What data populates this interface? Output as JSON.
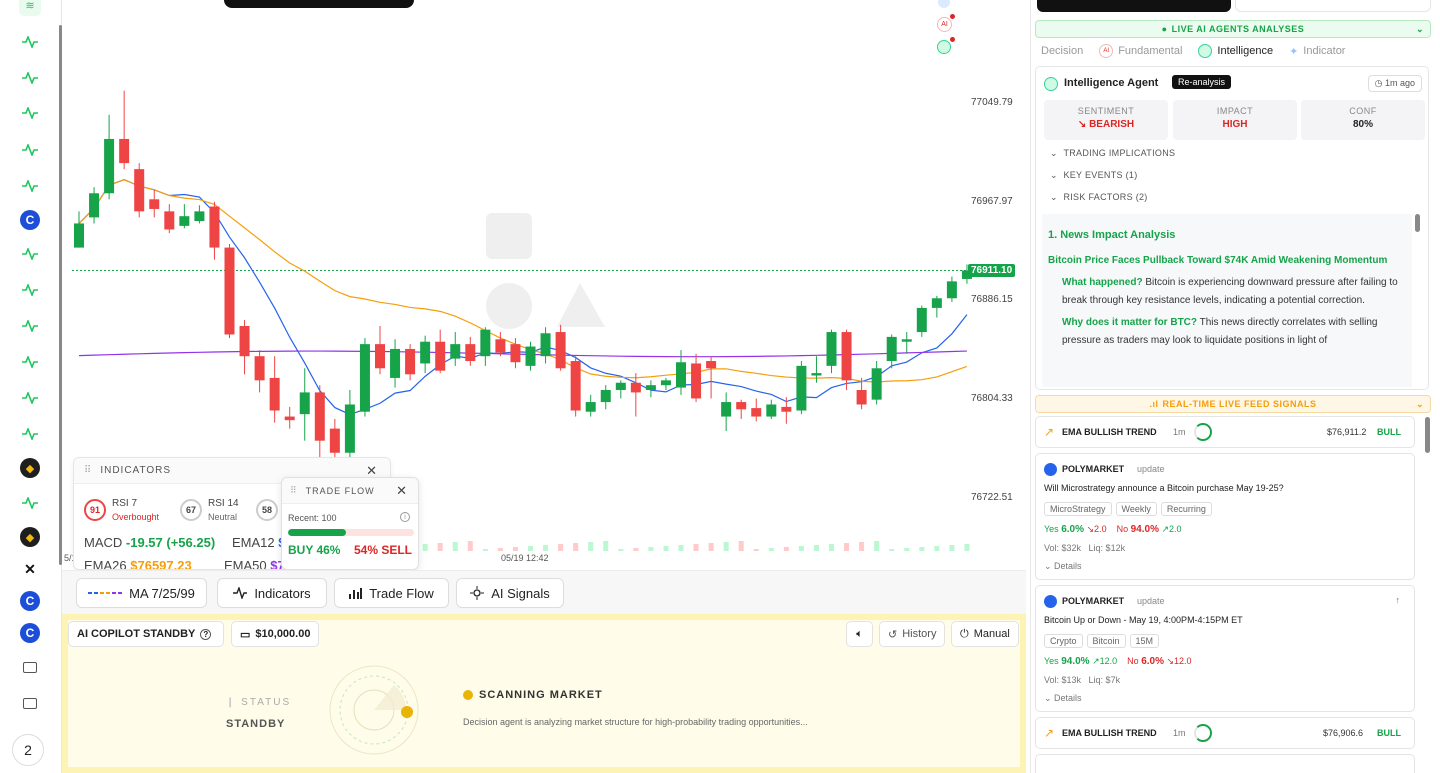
{
  "rail": {
    "icons": [
      "wifi-icon",
      "activity-icon",
      "activity-icon",
      "activity-icon",
      "activity-icon",
      "activity-icon",
      "coinbase-icon",
      "activity-icon",
      "activity-icon",
      "activity-icon",
      "activity-icon",
      "activity-icon",
      "activity-icon",
      "binance-icon",
      "activity-icon",
      "binance-icon",
      "okx-icon",
      "coinbase-icon",
      "coinbase-icon",
      "chat-icon",
      "chat-icon"
    ],
    "bottom_count": "2"
  },
  "chart": {
    "price_levels": [
      "77049.79",
      "76967.97",
      "76886.15",
      "76804.33",
      "76722.51"
    ],
    "current_price": "76911.10",
    "x_label": "05/19 12:42",
    "x_label_left": "5/1",
    "top_icons_badge": "AI"
  },
  "chart_data": {
    "type": "candlestick",
    "candles": [
      {
        "o": 76930,
        "c": 76950,
        "h": 76960,
        "l": 76930
      },
      {
        "o": 76955,
        "c": 76975,
        "h": 76980,
        "l": 76950
      },
      {
        "o": 76975,
        "c": 77020,
        "h": 77040,
        "l": 76970
      },
      {
        "o": 77020,
        "c": 77000,
        "h": 77060,
        "l": 76995
      },
      {
        "o": 76995,
        "c": 76960,
        "h": 77000,
        "l": 76955
      },
      {
        "o": 76970,
        "c": 76962,
        "h": 76978,
        "l": 76955
      },
      {
        "o": 76960,
        "c": 76945,
        "h": 76966,
        "l": 76942
      },
      {
        "o": 76948,
        "c": 76956,
        "h": 76966,
        "l": 76946
      },
      {
        "o": 76952,
        "c": 76960,
        "h": 76965,
        "l": 76950
      },
      {
        "o": 76964,
        "c": 76930,
        "h": 76968,
        "l": 76920
      },
      {
        "o": 76930,
        "c": 76858,
        "h": 76933,
        "l": 76855
      },
      {
        "o": 76865,
        "c": 76840,
        "h": 76870,
        "l": 76825
      },
      {
        "o": 76840,
        "c": 76820,
        "h": 76845,
        "l": 76810
      },
      {
        "o": 76822,
        "c": 76795,
        "h": 76840,
        "l": 76785
      },
      {
        "o": 76790,
        "c": 76787,
        "h": 76798,
        "l": 76780
      },
      {
        "o": 76792,
        "c": 76810,
        "h": 76830,
        "l": 76770
      },
      {
        "o": 76810,
        "c": 76770,
        "h": 76816,
        "l": 76755
      },
      {
        "o": 76780,
        "c": 76760,
        "h": 76788,
        "l": 76750
      },
      {
        "o": 76760,
        "c": 76800,
        "h": 76812,
        "l": 76732
      },
      {
        "o": 76794,
        "c": 76850,
        "h": 76855,
        "l": 76790
      },
      {
        "o": 76850,
        "c": 76830,
        "h": 76865,
        "l": 76825
      },
      {
        "o": 76822,
        "c": 76846,
        "h": 76854,
        "l": 76814
      },
      {
        "o": 76846,
        "c": 76825,
        "h": 76850,
        "l": 76820
      },
      {
        "o": 76834,
        "c": 76852,
        "h": 76857,
        "l": 76826
      },
      {
        "o": 76852,
        "c": 76828,
        "h": 76862,
        "l": 76826
      },
      {
        "o": 76838,
        "c": 76850,
        "h": 76860,
        "l": 76832
      },
      {
        "o": 76850,
        "c": 76836,
        "h": 76856,
        "l": 76832
      },
      {
        "o": 76840,
        "c": 76862,
        "h": 76864,
        "l": 76832
      },
      {
        "o": 76854,
        "c": 76843,
        "h": 76860,
        "l": 76840
      },
      {
        "o": 76850,
        "c": 76835,
        "h": 76855,
        "l": 76830
      },
      {
        "o": 76832,
        "c": 76848,
        "h": 76852,
        "l": 76828
      },
      {
        "o": 76840,
        "c": 76859,
        "h": 76864,
        "l": 76834
      },
      {
        "o": 76860,
        "c": 76830,
        "h": 76866,
        "l": 76828
      },
      {
        "o": 76836,
        "c": 76795,
        "h": 76840,
        "l": 76790
      },
      {
        "o": 76794,
        "c": 76802,
        "h": 76808,
        "l": 76790
      },
      {
        "o": 76802,
        "c": 76812,
        "h": 76816,
        "l": 76796
      },
      {
        "o": 76812,
        "c": 76818,
        "h": 76820,
        "l": 76805
      },
      {
        "o": 76818,
        "c": 76810,
        "h": 76826,
        "l": 76790
      },
      {
        "o": 76812,
        "c": 76816,
        "h": 76820,
        "l": 76806
      },
      {
        "o": 76816,
        "c": 76820,
        "h": 76822,
        "l": 76812
      },
      {
        "o": 76814,
        "c": 76835,
        "h": 76845,
        "l": 76808
      },
      {
        "o": 76834,
        "c": 76805,
        "h": 76842,
        "l": 76802
      },
      {
        "o": 76836,
        "c": 76830,
        "h": 76840,
        "l": 76805
      },
      {
        "o": 76790,
        "c": 76802,
        "h": 76810,
        "l": 76778
      },
      {
        "o": 76802,
        "c": 76796,
        "h": 76804,
        "l": 76788
      },
      {
        "o": 76797,
        "c": 76790,
        "h": 76805,
        "l": 76786
      },
      {
        "o": 76790,
        "c": 76800,
        "h": 76804,
        "l": 76788
      },
      {
        "o": 76798,
        "c": 76794,
        "h": 76806,
        "l": 76784
      },
      {
        "o": 76795,
        "c": 76832,
        "h": 76836,
        "l": 76792
      },
      {
        "o": 76824,
        "c": 76826,
        "h": 76840,
        "l": 76818
      },
      {
        "o": 76832,
        "c": 76860,
        "h": 76862,
        "l": 76826
      },
      {
        "o": 76860,
        "c": 76820,
        "h": 76862,
        "l": 76812
      },
      {
        "o": 76812,
        "c": 76800,
        "h": 76822,
        "l": 76796
      },
      {
        "o": 76804,
        "c": 76830,
        "h": 76836,
        "l": 76800
      },
      {
        "o": 76836,
        "c": 76856,
        "h": 76858,
        "l": 76830
      },
      {
        "o": 76852,
        "c": 76854,
        "h": 76860,
        "l": 76842
      },
      {
        "o": 76860,
        "c": 76880,
        "h": 76882,
        "l": 76856
      },
      {
        "o": 76880,
        "c": 76888,
        "h": 76890,
        "l": 76872
      },
      {
        "o": 76888,
        "c": 76902,
        "h": 76906,
        "l": 76885
      },
      {
        "o": 76904,
        "c": 76911,
        "h": 76916,
        "l": 76900
      }
    ],
    "series": [
      {
        "name": "MA 7",
        "color": "#2563eb"
      },
      {
        "name": "MA 25",
        "color": "#f59e0b"
      },
      {
        "name": "MA 99",
        "color": "#9333ea"
      }
    ],
    "ylim": [
      76722.51,
      77049.79
    ]
  },
  "indicators": {
    "title": "INDICATORS",
    "rsi7_label": "RSI 7",
    "rsi7_value": "91",
    "rsi7_state": "Overbought",
    "rsi14_label": "RSI 14",
    "rsi14_value": "67",
    "rsi14_state": "Neutral",
    "rsi_third_value": "58",
    "macd_label": "MACD",
    "macd_value": "-19.57 (+56.25)",
    "ema12_label": "EMA12",
    "ema12_value": "$",
    "ema26_label": "EMA26",
    "ema26_value": "$76597.23",
    "ema50_label": "EMA50",
    "ema50_value": "$76"
  },
  "trade_flow": {
    "title": "TRADE FLOW",
    "recent": "Recent: 100",
    "buy_pct": 0.46,
    "buy_label": "BUY 46%",
    "sell_label": "54% SELL"
  },
  "toolbar": {
    "ma_label": "MA 7/25/99",
    "indicators_label": "Indicators",
    "tradeflow_label": "Trade Flow",
    "ai_signals_label": "AI Signals"
  },
  "copilot": {
    "status_label": "AI COPILOT STANDBY",
    "balance": "$10,000.00",
    "history_label": "History",
    "manual_label": "Manual",
    "status_caption": "STATUS",
    "status_value": "STANDBY",
    "scanning_title": "SCANNING MARKET",
    "scanning_desc": "Decision agent is analyzing market structure for high-probability trading opportunities..."
  },
  "right": {
    "live_ai": "LIVE AI AGENTS ANALYSES",
    "tabs": [
      "Decision",
      "Fundamental",
      "Intelligence",
      "Indicator"
    ],
    "agent_name": "Intelligence Agent",
    "reanalysis": "Re-analysis",
    "time_ago": "1m ago",
    "metrics": [
      {
        "label": "SENTIMENT",
        "value": "BEARISH",
        "color": "#dc2626"
      },
      {
        "label": "IMPACT",
        "value": "HIGH",
        "color": "#dc2626"
      },
      {
        "label": "CONF",
        "value": "80%",
        "color": "#222"
      }
    ],
    "accordions": [
      "TRADING IMPLICATIONS",
      "KEY EVENTS (1)",
      "RISK FACTORS (2)"
    ],
    "analysis_heading": "1. News Impact Analysis",
    "analysis_title": "Bitcoin Price Faces Pullback Toward $74K Amid Weakening Momentum",
    "what_q": "What happened?",
    "what_a": "Bitcoin is experiencing downward pressure after failing to break through key resistance levels, indicating a potential correction.",
    "why_q": "Why does it matter for BTC?",
    "why_a": "This news directly correlates with selling pressure as traders may look to liquidate positions in light of",
    "live_feed": "REAL-TIME LIVE FEED SIGNALS",
    "ema1": {
      "label": "EMA BULLISH TREND",
      "tf": "1m",
      "price": "$76,911.2",
      "signal": "BULL"
    },
    "poly1": {
      "source": "POLYMARKET",
      "kind": "update",
      "question": "Will Microstrategy announce a Bitcoin purchase May 19-25?",
      "tags": [
        "MicroStrategy",
        "Weekly",
        "Recurring"
      ],
      "yes_label": "Yes",
      "yes_pct": "6.0%",
      "yes_delta": "↘2.0",
      "no_label": "No",
      "no_pct": "94.0%",
      "no_delta": "↗2.0",
      "vol": "Vol: $32k",
      "liq": "Liq: $12k",
      "details": "Details"
    },
    "poly2": {
      "source": "POLYMARKET",
      "kind": "update",
      "question": "Bitcoin Up or Down - May 19, 4:00PM-4:15PM ET",
      "tags": [
        "Crypto",
        "Bitcoin",
        "15M"
      ],
      "yes_label": "Yes",
      "yes_pct": "94.0%",
      "yes_delta": "↗12.0",
      "no_label": "No",
      "no_pct": "6.0%",
      "no_delta": "↘12.0",
      "vol": "Vol: $13k",
      "liq": "Liq: $7k",
      "details": "Details"
    },
    "ema2": {
      "label": "EMA BULLISH TREND",
      "tf": "1m",
      "price": "$76,906.6",
      "signal": "BULL"
    }
  }
}
